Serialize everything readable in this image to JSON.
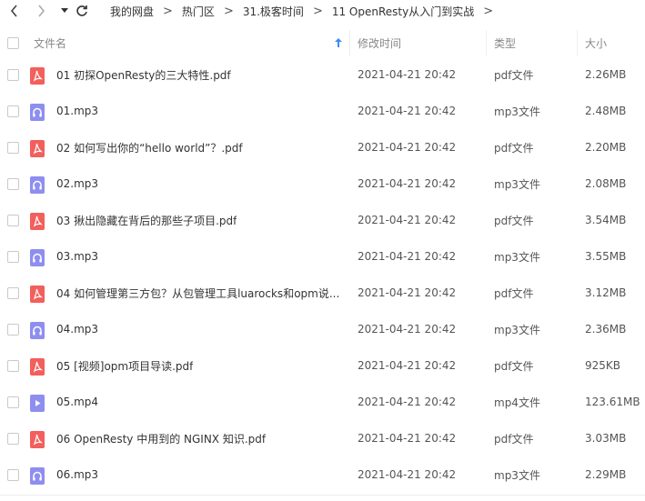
{
  "breadcrumb": [
    "我的网盘",
    "热门区",
    "31.极客时间",
    "11 OpenResty从入门到实战"
  ],
  "header": {
    "name": "文件名",
    "modified": "修改时间",
    "type": "类型",
    "size": "大小"
  },
  "files": [
    {
      "name": "01 初探OpenResty的三大特性.pdf",
      "time": "2021-04-21 20:42",
      "type": "pdf文件",
      "size": "2.26MB",
      "kind": "pdf"
    },
    {
      "name": "01.mp3",
      "time": "2021-04-21 20:42",
      "type": "mp3文件",
      "size": "2.48MB",
      "kind": "mp3"
    },
    {
      "name": "02 如何写出你的“hello world”？.pdf",
      "time": "2021-04-21 20:42",
      "type": "pdf文件",
      "size": "2.20MB",
      "kind": "pdf"
    },
    {
      "name": "02.mp3",
      "time": "2021-04-21 20:42",
      "type": "mp3文件",
      "size": "2.08MB",
      "kind": "mp3"
    },
    {
      "name": "03 揪出隐藏在背后的那些子项目.pdf",
      "time": "2021-04-21 20:42",
      "type": "pdf文件",
      "size": "3.54MB",
      "kind": "pdf"
    },
    {
      "name": "03.mp3",
      "time": "2021-04-21 20:42",
      "type": "mp3文件",
      "size": "3.55MB",
      "kind": "mp3"
    },
    {
      "name": "04 如何管理第三方包？从包管理工具luarocks和opm说...",
      "time": "2021-04-21 20:42",
      "type": "pdf文件",
      "size": "3.12MB",
      "kind": "pdf"
    },
    {
      "name": "04.mp3",
      "time": "2021-04-21 20:42",
      "type": "mp3文件",
      "size": "2.36MB",
      "kind": "mp3"
    },
    {
      "name": "05 [视频]opm项目导读.pdf",
      "time": "2021-04-21 20:42",
      "type": "pdf文件",
      "size": "925KB",
      "kind": "pdf"
    },
    {
      "name": "05.mp4",
      "time": "2021-04-21 20:42",
      "type": "mp4文件",
      "size": "123.61MB",
      "kind": "mp4"
    },
    {
      "name": "06  OpenResty 中用到的 NGINX 知识.pdf",
      "time": "2021-04-21 20:42",
      "type": "pdf文件",
      "size": "3.03MB",
      "kind": "pdf"
    },
    {
      "name": "06.mp3",
      "time": "2021-04-21 20:42",
      "type": "mp3文件",
      "size": "2.29MB",
      "kind": "mp3"
    }
  ],
  "colors": {
    "pdf": "#f25f5c",
    "mp3": "#8e8ef0",
    "mp4": "#8e8ef0",
    "sort_arrow": "#3b8cf5"
  }
}
